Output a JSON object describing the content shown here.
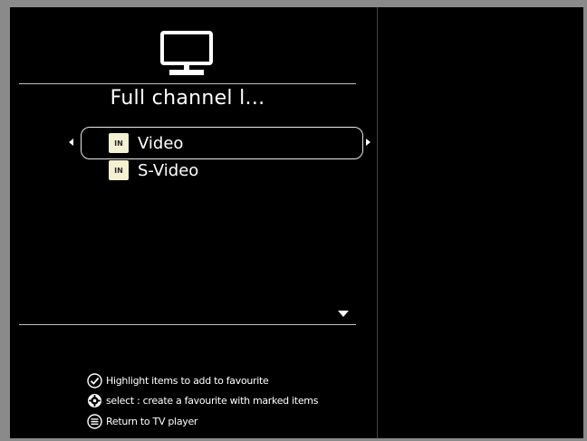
{
  "panel": {
    "icon": "tv-icon",
    "title": "Full channel l..."
  },
  "list": {
    "items": [
      {
        "badge": "IN",
        "label": "Video",
        "selected": true
      },
      {
        "badge": "IN",
        "label": "S-Video",
        "selected": false
      }
    ]
  },
  "help": {
    "items": [
      {
        "icon": "checkmark-icon",
        "text": "Highlight items to add to favourite"
      },
      {
        "icon": "settings-icon",
        "text": "select : create a favourite with marked items"
      },
      {
        "icon": "menu-icon",
        "text": "Return to TV player"
      }
    ]
  },
  "colors": {
    "background": "#000000",
    "frame": "#8a8a8a",
    "badge": "#f4f0d2",
    "text": "#ffffff"
  }
}
